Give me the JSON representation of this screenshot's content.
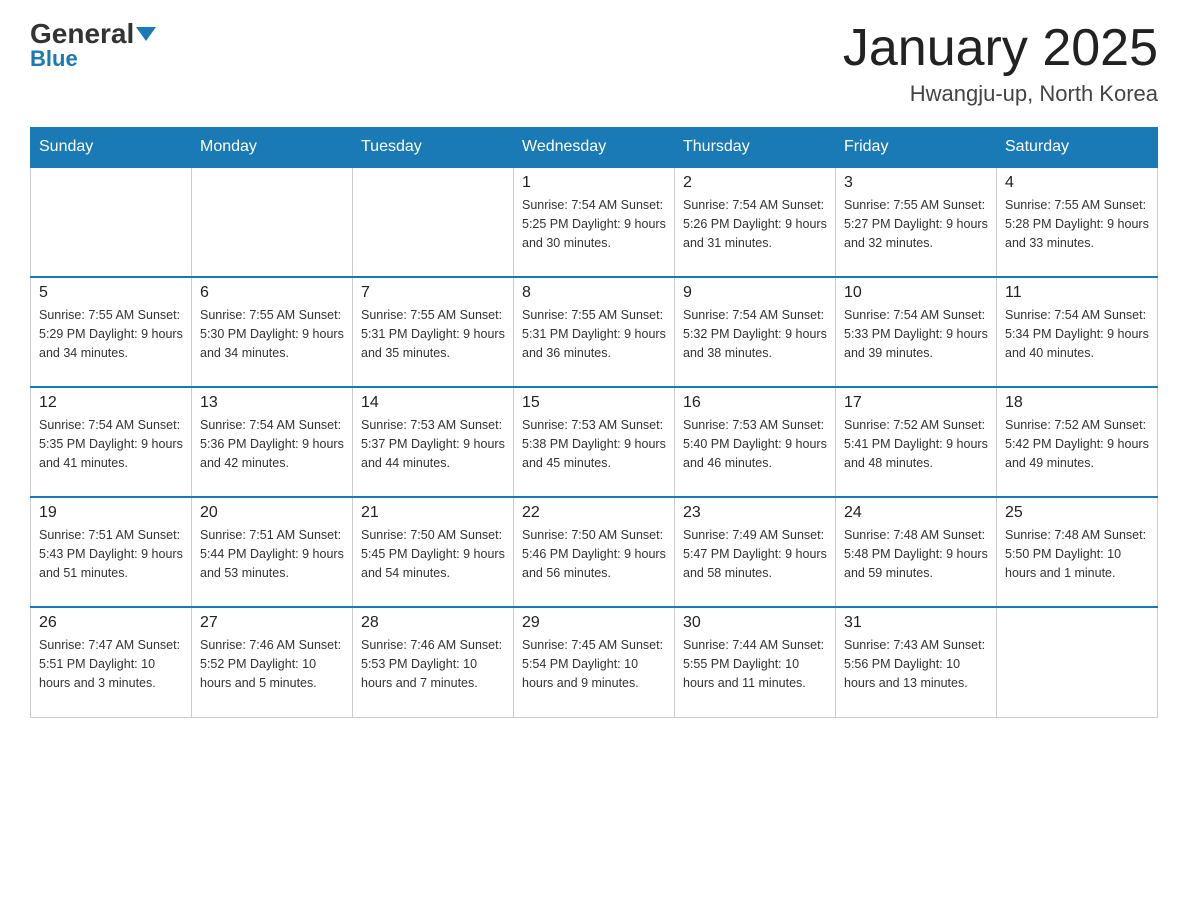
{
  "header": {
    "logo_general": "General",
    "logo_blue": "Blue",
    "month_title": "January 2025",
    "location": "Hwangju-up, North Korea"
  },
  "days_of_week": [
    "Sunday",
    "Monday",
    "Tuesday",
    "Wednesday",
    "Thursday",
    "Friday",
    "Saturday"
  ],
  "weeks": [
    [
      {
        "day": "",
        "info": ""
      },
      {
        "day": "",
        "info": ""
      },
      {
        "day": "",
        "info": ""
      },
      {
        "day": "1",
        "info": "Sunrise: 7:54 AM\nSunset: 5:25 PM\nDaylight: 9 hours\nand 30 minutes."
      },
      {
        "day": "2",
        "info": "Sunrise: 7:54 AM\nSunset: 5:26 PM\nDaylight: 9 hours\nand 31 minutes."
      },
      {
        "day": "3",
        "info": "Sunrise: 7:55 AM\nSunset: 5:27 PM\nDaylight: 9 hours\nand 32 minutes."
      },
      {
        "day": "4",
        "info": "Sunrise: 7:55 AM\nSunset: 5:28 PM\nDaylight: 9 hours\nand 33 minutes."
      }
    ],
    [
      {
        "day": "5",
        "info": "Sunrise: 7:55 AM\nSunset: 5:29 PM\nDaylight: 9 hours\nand 34 minutes."
      },
      {
        "day": "6",
        "info": "Sunrise: 7:55 AM\nSunset: 5:30 PM\nDaylight: 9 hours\nand 34 minutes."
      },
      {
        "day": "7",
        "info": "Sunrise: 7:55 AM\nSunset: 5:31 PM\nDaylight: 9 hours\nand 35 minutes."
      },
      {
        "day": "8",
        "info": "Sunrise: 7:55 AM\nSunset: 5:31 PM\nDaylight: 9 hours\nand 36 minutes."
      },
      {
        "day": "9",
        "info": "Sunrise: 7:54 AM\nSunset: 5:32 PM\nDaylight: 9 hours\nand 38 minutes."
      },
      {
        "day": "10",
        "info": "Sunrise: 7:54 AM\nSunset: 5:33 PM\nDaylight: 9 hours\nand 39 minutes."
      },
      {
        "day": "11",
        "info": "Sunrise: 7:54 AM\nSunset: 5:34 PM\nDaylight: 9 hours\nand 40 minutes."
      }
    ],
    [
      {
        "day": "12",
        "info": "Sunrise: 7:54 AM\nSunset: 5:35 PM\nDaylight: 9 hours\nand 41 minutes."
      },
      {
        "day": "13",
        "info": "Sunrise: 7:54 AM\nSunset: 5:36 PM\nDaylight: 9 hours\nand 42 minutes."
      },
      {
        "day": "14",
        "info": "Sunrise: 7:53 AM\nSunset: 5:37 PM\nDaylight: 9 hours\nand 44 minutes."
      },
      {
        "day": "15",
        "info": "Sunrise: 7:53 AM\nSunset: 5:38 PM\nDaylight: 9 hours\nand 45 minutes."
      },
      {
        "day": "16",
        "info": "Sunrise: 7:53 AM\nSunset: 5:40 PM\nDaylight: 9 hours\nand 46 minutes."
      },
      {
        "day": "17",
        "info": "Sunrise: 7:52 AM\nSunset: 5:41 PM\nDaylight: 9 hours\nand 48 minutes."
      },
      {
        "day": "18",
        "info": "Sunrise: 7:52 AM\nSunset: 5:42 PM\nDaylight: 9 hours\nand 49 minutes."
      }
    ],
    [
      {
        "day": "19",
        "info": "Sunrise: 7:51 AM\nSunset: 5:43 PM\nDaylight: 9 hours\nand 51 minutes."
      },
      {
        "day": "20",
        "info": "Sunrise: 7:51 AM\nSunset: 5:44 PM\nDaylight: 9 hours\nand 53 minutes."
      },
      {
        "day": "21",
        "info": "Sunrise: 7:50 AM\nSunset: 5:45 PM\nDaylight: 9 hours\nand 54 minutes."
      },
      {
        "day": "22",
        "info": "Sunrise: 7:50 AM\nSunset: 5:46 PM\nDaylight: 9 hours\nand 56 minutes."
      },
      {
        "day": "23",
        "info": "Sunrise: 7:49 AM\nSunset: 5:47 PM\nDaylight: 9 hours\nand 58 minutes."
      },
      {
        "day": "24",
        "info": "Sunrise: 7:48 AM\nSunset: 5:48 PM\nDaylight: 9 hours\nand 59 minutes."
      },
      {
        "day": "25",
        "info": "Sunrise: 7:48 AM\nSunset: 5:50 PM\nDaylight: 10 hours\nand 1 minute."
      }
    ],
    [
      {
        "day": "26",
        "info": "Sunrise: 7:47 AM\nSunset: 5:51 PM\nDaylight: 10 hours\nand 3 minutes."
      },
      {
        "day": "27",
        "info": "Sunrise: 7:46 AM\nSunset: 5:52 PM\nDaylight: 10 hours\nand 5 minutes."
      },
      {
        "day": "28",
        "info": "Sunrise: 7:46 AM\nSunset: 5:53 PM\nDaylight: 10 hours\nand 7 minutes."
      },
      {
        "day": "29",
        "info": "Sunrise: 7:45 AM\nSunset: 5:54 PM\nDaylight: 10 hours\nand 9 minutes."
      },
      {
        "day": "30",
        "info": "Sunrise: 7:44 AM\nSunset: 5:55 PM\nDaylight: 10 hours\nand 11 minutes."
      },
      {
        "day": "31",
        "info": "Sunrise: 7:43 AM\nSunset: 5:56 PM\nDaylight: 10 hours\nand 13 minutes."
      },
      {
        "day": "",
        "info": ""
      }
    ]
  ]
}
